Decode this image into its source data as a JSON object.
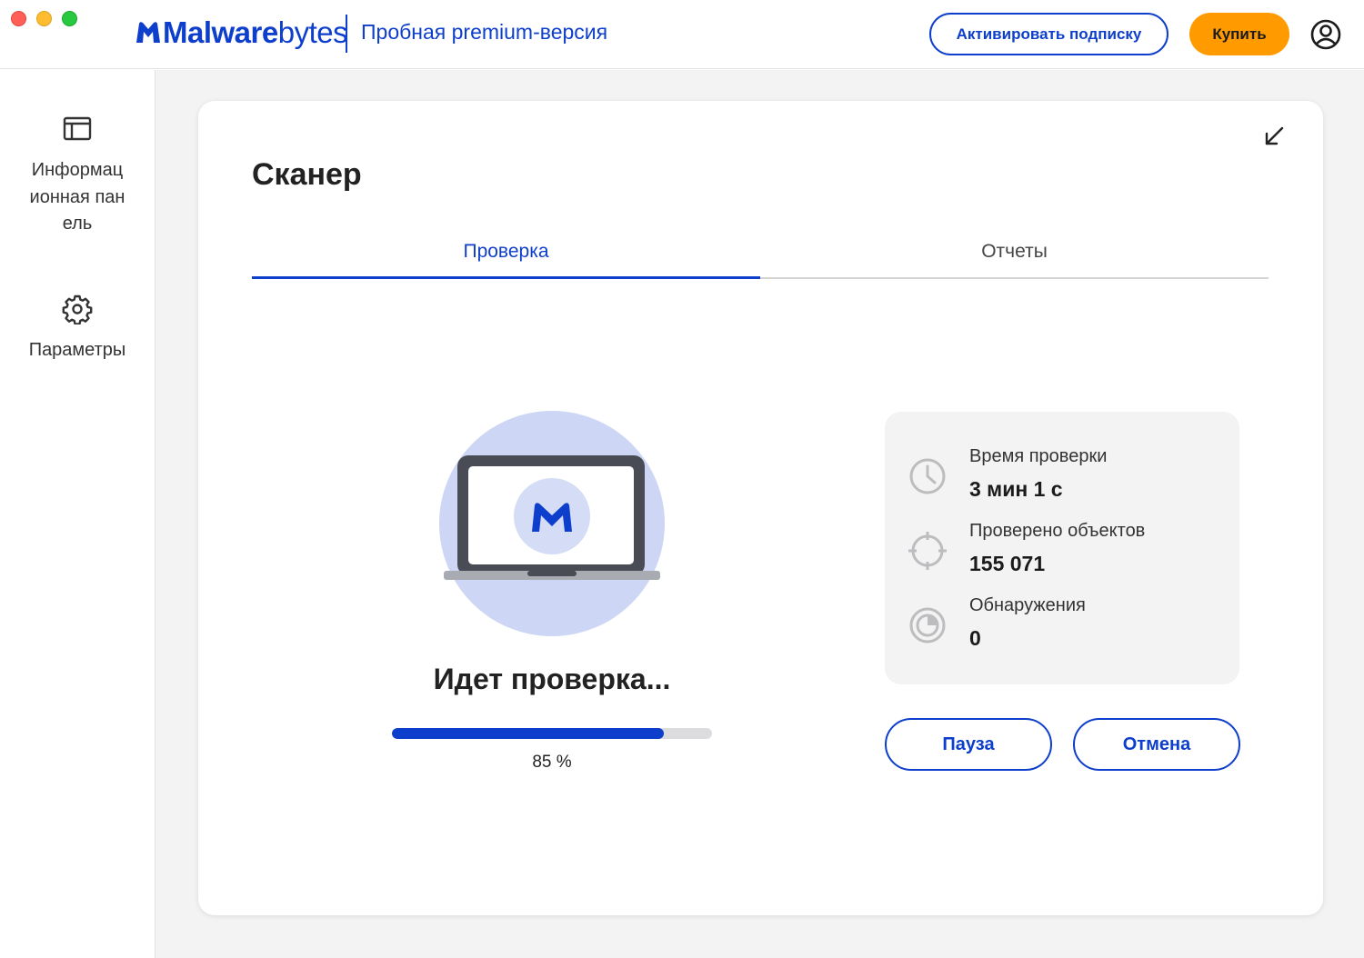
{
  "header": {
    "logo_bold": "Malware",
    "logo_light": "bytes",
    "edition": "Пробная premium-версия",
    "activate_label": "Активировать подписку",
    "buy_label": "Купить",
    "account_icon": "user-circle-icon"
  },
  "sidebar": {
    "items": [
      {
        "label": "Информационная панель",
        "icon": "dashboard-icon"
      },
      {
        "label": "Параметры",
        "icon": "gear-icon"
      }
    ]
  },
  "scanner": {
    "title": "Сканер",
    "collapse_icon": "collapse-arrow-icon",
    "tabs": [
      {
        "label": "Проверка",
        "active": true
      },
      {
        "label": "Отчеты",
        "active": false
      }
    ],
    "status": "Идет проверка...",
    "progress_fraction": 0.85,
    "progress_text": "85 %",
    "stats": [
      {
        "label": "Время проверки",
        "value": "3 мин 1 с",
        "icon": "clock-icon"
      },
      {
        "label": "Проверено объектов",
        "value": "155 071",
        "icon": "crosshair-icon"
      },
      {
        "label": "Обнаружения",
        "value": "0",
        "icon": "radar-icon"
      }
    ],
    "pause_label": "Пауза",
    "cancel_label": "Отмена"
  },
  "colors": {
    "brand_blue": "#0d3ecc",
    "buy_orange": "#ff9a00",
    "illustration_circle": "#cdd6f4"
  }
}
